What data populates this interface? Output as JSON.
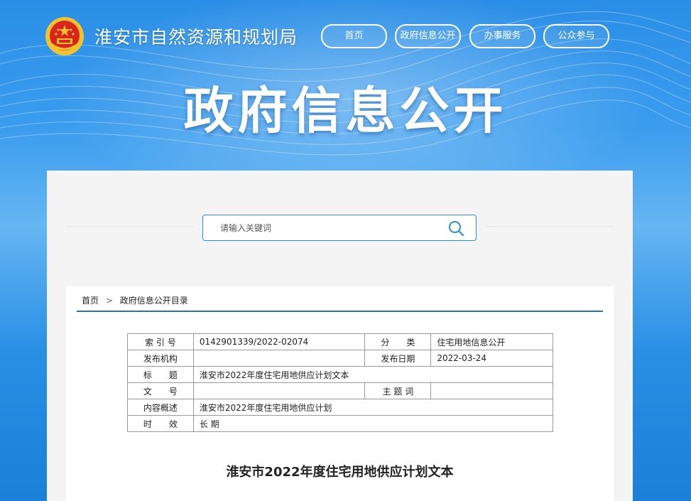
{
  "header": {
    "site_title": "淮安市自然资源和规划局",
    "nav": [
      {
        "label": "首页"
      },
      {
        "label": "政府信息公开"
      },
      {
        "label": "办事服务"
      },
      {
        "label": "公众参与"
      }
    ],
    "hero_title": "政府信息公开"
  },
  "search": {
    "placeholder": "请输入关键词",
    "value": ""
  },
  "breadcrumb": {
    "home": "首页",
    "separator": ">",
    "current": "政府信息公开目录"
  },
  "meta": {
    "index_label": "索 引 号",
    "index_value": "0142901339/2022-02074",
    "category_label": "分　　类",
    "category_value": "住宅用地信息公开",
    "issuer_label": "发布机构",
    "issuer_value": "",
    "date_label": "发布日期",
    "date_value": "2022-03-24",
    "title_label": "标　　题",
    "title_value": "淮安市2022年度住宅用地供应计划文本",
    "docno_label": "文　　号",
    "docno_value": "",
    "subject_label": "主 题 词",
    "subject_value": "",
    "summary_label": "内容概述",
    "summary_value": "淮安市2022年度住宅用地供应计划",
    "validity_label": "时　　效",
    "validity_value": "长 期"
  },
  "document": {
    "title": "淮安市2022年度住宅用地供应计划文本"
  },
  "colors": {
    "primary_blue": "#2f8be0",
    "rule_blue": "#2a70b8",
    "emblem_red": "#d8261c",
    "emblem_gold": "#f2c230"
  }
}
